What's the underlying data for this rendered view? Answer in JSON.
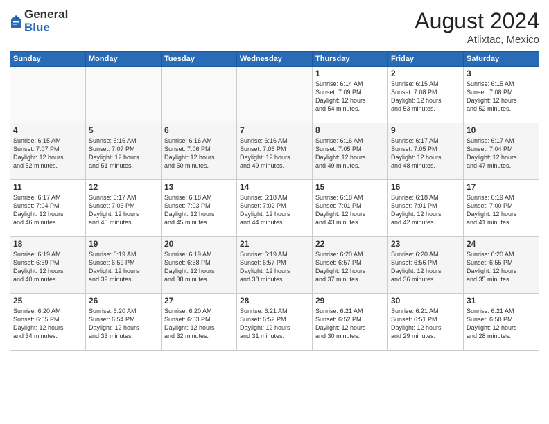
{
  "logo": {
    "general": "General",
    "blue": "Blue"
  },
  "header": {
    "month_year": "August 2024",
    "location": "Atlixtac, Mexico"
  },
  "days_of_week": [
    "Sunday",
    "Monday",
    "Tuesday",
    "Wednesday",
    "Thursday",
    "Friday",
    "Saturday"
  ],
  "weeks": [
    [
      {
        "day": "",
        "text": ""
      },
      {
        "day": "",
        "text": ""
      },
      {
        "day": "",
        "text": ""
      },
      {
        "day": "",
        "text": ""
      },
      {
        "day": "1",
        "text": "Sunrise: 6:14 AM\nSunset: 7:09 PM\nDaylight: 12 hours\nand 54 minutes."
      },
      {
        "day": "2",
        "text": "Sunrise: 6:15 AM\nSunset: 7:08 PM\nDaylight: 12 hours\nand 53 minutes."
      },
      {
        "day": "3",
        "text": "Sunrise: 6:15 AM\nSunset: 7:08 PM\nDaylight: 12 hours\nand 52 minutes."
      }
    ],
    [
      {
        "day": "4",
        "text": "Sunrise: 6:15 AM\nSunset: 7:07 PM\nDaylight: 12 hours\nand 52 minutes."
      },
      {
        "day": "5",
        "text": "Sunrise: 6:16 AM\nSunset: 7:07 PM\nDaylight: 12 hours\nand 51 minutes."
      },
      {
        "day": "6",
        "text": "Sunrise: 6:16 AM\nSunset: 7:06 PM\nDaylight: 12 hours\nand 50 minutes."
      },
      {
        "day": "7",
        "text": "Sunrise: 6:16 AM\nSunset: 7:06 PM\nDaylight: 12 hours\nand 49 minutes."
      },
      {
        "day": "8",
        "text": "Sunrise: 6:16 AM\nSunset: 7:05 PM\nDaylight: 12 hours\nand 49 minutes."
      },
      {
        "day": "9",
        "text": "Sunrise: 6:17 AM\nSunset: 7:05 PM\nDaylight: 12 hours\nand 48 minutes."
      },
      {
        "day": "10",
        "text": "Sunrise: 6:17 AM\nSunset: 7:04 PM\nDaylight: 12 hours\nand 47 minutes."
      }
    ],
    [
      {
        "day": "11",
        "text": "Sunrise: 6:17 AM\nSunset: 7:04 PM\nDaylight: 12 hours\nand 46 minutes."
      },
      {
        "day": "12",
        "text": "Sunrise: 6:17 AM\nSunset: 7:03 PM\nDaylight: 12 hours\nand 45 minutes."
      },
      {
        "day": "13",
        "text": "Sunrise: 6:18 AM\nSunset: 7:03 PM\nDaylight: 12 hours\nand 45 minutes."
      },
      {
        "day": "14",
        "text": "Sunrise: 6:18 AM\nSunset: 7:02 PM\nDaylight: 12 hours\nand 44 minutes."
      },
      {
        "day": "15",
        "text": "Sunrise: 6:18 AM\nSunset: 7:01 PM\nDaylight: 12 hours\nand 43 minutes."
      },
      {
        "day": "16",
        "text": "Sunrise: 6:18 AM\nSunset: 7:01 PM\nDaylight: 12 hours\nand 42 minutes."
      },
      {
        "day": "17",
        "text": "Sunrise: 6:19 AM\nSunset: 7:00 PM\nDaylight: 12 hours\nand 41 minutes."
      }
    ],
    [
      {
        "day": "18",
        "text": "Sunrise: 6:19 AM\nSunset: 6:59 PM\nDaylight: 12 hours\nand 40 minutes."
      },
      {
        "day": "19",
        "text": "Sunrise: 6:19 AM\nSunset: 6:59 PM\nDaylight: 12 hours\nand 39 minutes."
      },
      {
        "day": "20",
        "text": "Sunrise: 6:19 AM\nSunset: 6:58 PM\nDaylight: 12 hours\nand 38 minutes."
      },
      {
        "day": "21",
        "text": "Sunrise: 6:19 AM\nSunset: 6:57 PM\nDaylight: 12 hours\nand 38 minutes."
      },
      {
        "day": "22",
        "text": "Sunrise: 6:20 AM\nSunset: 6:57 PM\nDaylight: 12 hours\nand 37 minutes."
      },
      {
        "day": "23",
        "text": "Sunrise: 6:20 AM\nSunset: 6:56 PM\nDaylight: 12 hours\nand 36 minutes."
      },
      {
        "day": "24",
        "text": "Sunrise: 6:20 AM\nSunset: 6:55 PM\nDaylight: 12 hours\nand 35 minutes."
      }
    ],
    [
      {
        "day": "25",
        "text": "Sunrise: 6:20 AM\nSunset: 6:55 PM\nDaylight: 12 hours\nand 34 minutes."
      },
      {
        "day": "26",
        "text": "Sunrise: 6:20 AM\nSunset: 6:54 PM\nDaylight: 12 hours\nand 33 minutes."
      },
      {
        "day": "27",
        "text": "Sunrise: 6:20 AM\nSunset: 6:53 PM\nDaylight: 12 hours\nand 32 minutes."
      },
      {
        "day": "28",
        "text": "Sunrise: 6:21 AM\nSunset: 6:52 PM\nDaylight: 12 hours\nand 31 minutes."
      },
      {
        "day": "29",
        "text": "Sunrise: 6:21 AM\nSunset: 6:52 PM\nDaylight: 12 hours\nand 30 minutes."
      },
      {
        "day": "30",
        "text": "Sunrise: 6:21 AM\nSunset: 6:51 PM\nDaylight: 12 hours\nand 29 minutes."
      },
      {
        "day": "31",
        "text": "Sunrise: 6:21 AM\nSunset: 6:50 PM\nDaylight: 12 hours\nand 28 minutes."
      }
    ]
  ]
}
